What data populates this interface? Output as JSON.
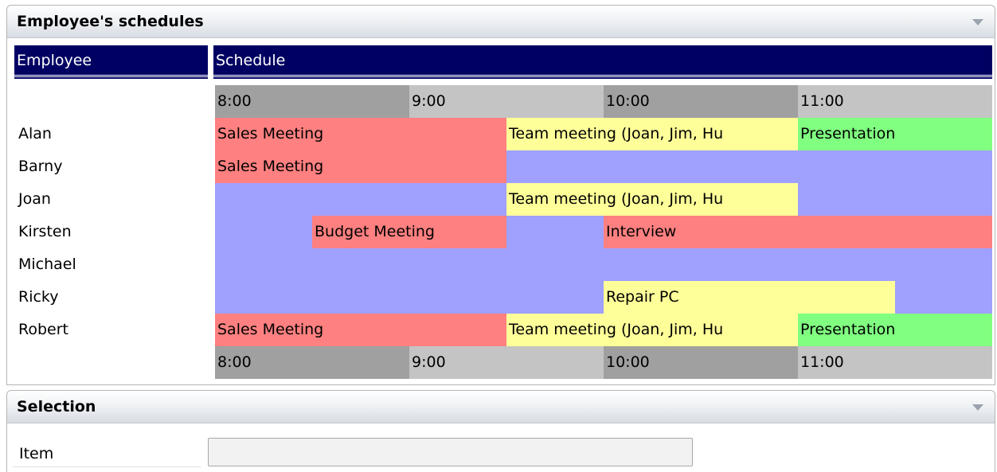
{
  "panels": {
    "schedule": {
      "title": "Employee's schedules"
    },
    "selection": {
      "title": "Selection"
    }
  },
  "grid": {
    "employee_header": "Employee",
    "schedule_header": "Schedule",
    "time_labels": [
      "8:00",
      "9:00",
      "10:00",
      "11:00"
    ],
    "employees": [
      "Alan",
      "Barny",
      "Joan",
      "Kirsten",
      "Michael",
      "Ricky",
      "Robert"
    ],
    "events": [
      [
        "Sales Meeting",
        "Team meeting (Joan, Jim, Hu",
        "Presentation"
      ],
      [
        "Sales Meeting"
      ],
      [
        "Team meeting (Joan, Jim, Hu"
      ],
      [
        "Budget Meeting",
        "Interview"
      ],
      [],
      [
        "Repair PC"
      ],
      [
        "Sales Meeting",
        "Team meeting (Joan, Jim, Hu",
        "Presentation"
      ]
    ]
  },
  "selection": {
    "item_label": "Item",
    "item_value": ""
  },
  "colors": {
    "header_bg": "#000063",
    "free_slot": "#a0a0ff",
    "meeting_red": "#ff8080",
    "meeting_yellow": "#ffff99",
    "meeting_green": "#80ff80",
    "hour_dark": "#a0a0a0",
    "hour_light": "#c4c4c4"
  }
}
